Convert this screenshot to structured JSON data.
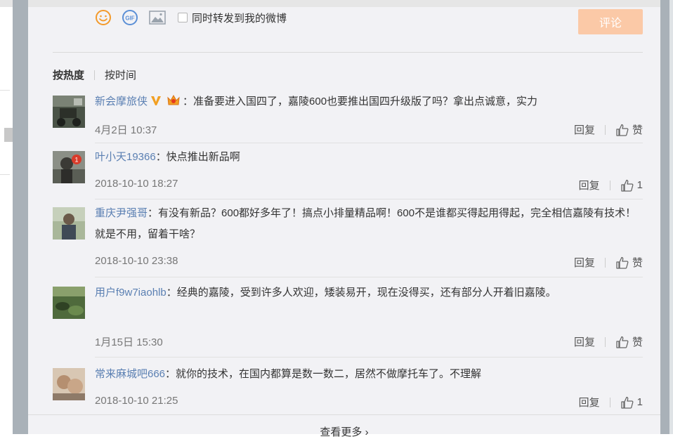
{
  "composer": {
    "emoji_icon": "smiley-face-icon",
    "gif_label": "GIF",
    "image_icon": "picture-icon",
    "forward_label": "同时转发到我的微博",
    "submit_label": "评论",
    "submit_color": "#fbc9a7"
  },
  "sort": {
    "hot_label": "按热度",
    "time_label": "按时间"
  },
  "comments": [
    {
      "user": "新会摩旅侠",
      "badges": [
        "verified-v-icon",
        "crown-badge-icon"
      ],
      "text": "：准备要进入国四了，嘉陵600也要推出国四升级版了吗？拿出点诚意，实力",
      "time": "4月2日 10:37",
      "reply_label": "回复",
      "like_label": "赞"
    },
    {
      "user": "叶小天19366",
      "text": "：快点推出新品啊",
      "time": "2018-10-10 18:27",
      "reply_label": "回复",
      "like_label": "1"
    },
    {
      "user": "重庆尹强哥",
      "text": "：有没有新品？600都好多年了！搞点小排量精品啊！600不是谁都买得起用得起，完全相信嘉陵有技术！就是不用，留着干啥？",
      "time": "2018-10-10 23:38",
      "reply_label": "回复",
      "like_label": "赞"
    },
    {
      "user": "用户f9w7iaohlb",
      "text": "：经典的嘉陵，受到许多人欢迎，矮装易开，现在没得买，还有部分人开着旧嘉陵。",
      "time": "1月15日 15:30",
      "reply_label": "回复",
      "like_label": "赞"
    },
    {
      "user": "常来麻城吧666",
      "text": "：就你的技术，在国内都算是数一数二，居然不做摩托车了。不理解",
      "time": "2018-10-10 21:25",
      "reply_label": "回复",
      "like_label": "1"
    }
  ],
  "more_label": "查看更多 ›",
  "colors": {
    "username": "#5a7fb2",
    "panel_bg": "#f2f2f5",
    "frame": "#a9b1b8"
  }
}
